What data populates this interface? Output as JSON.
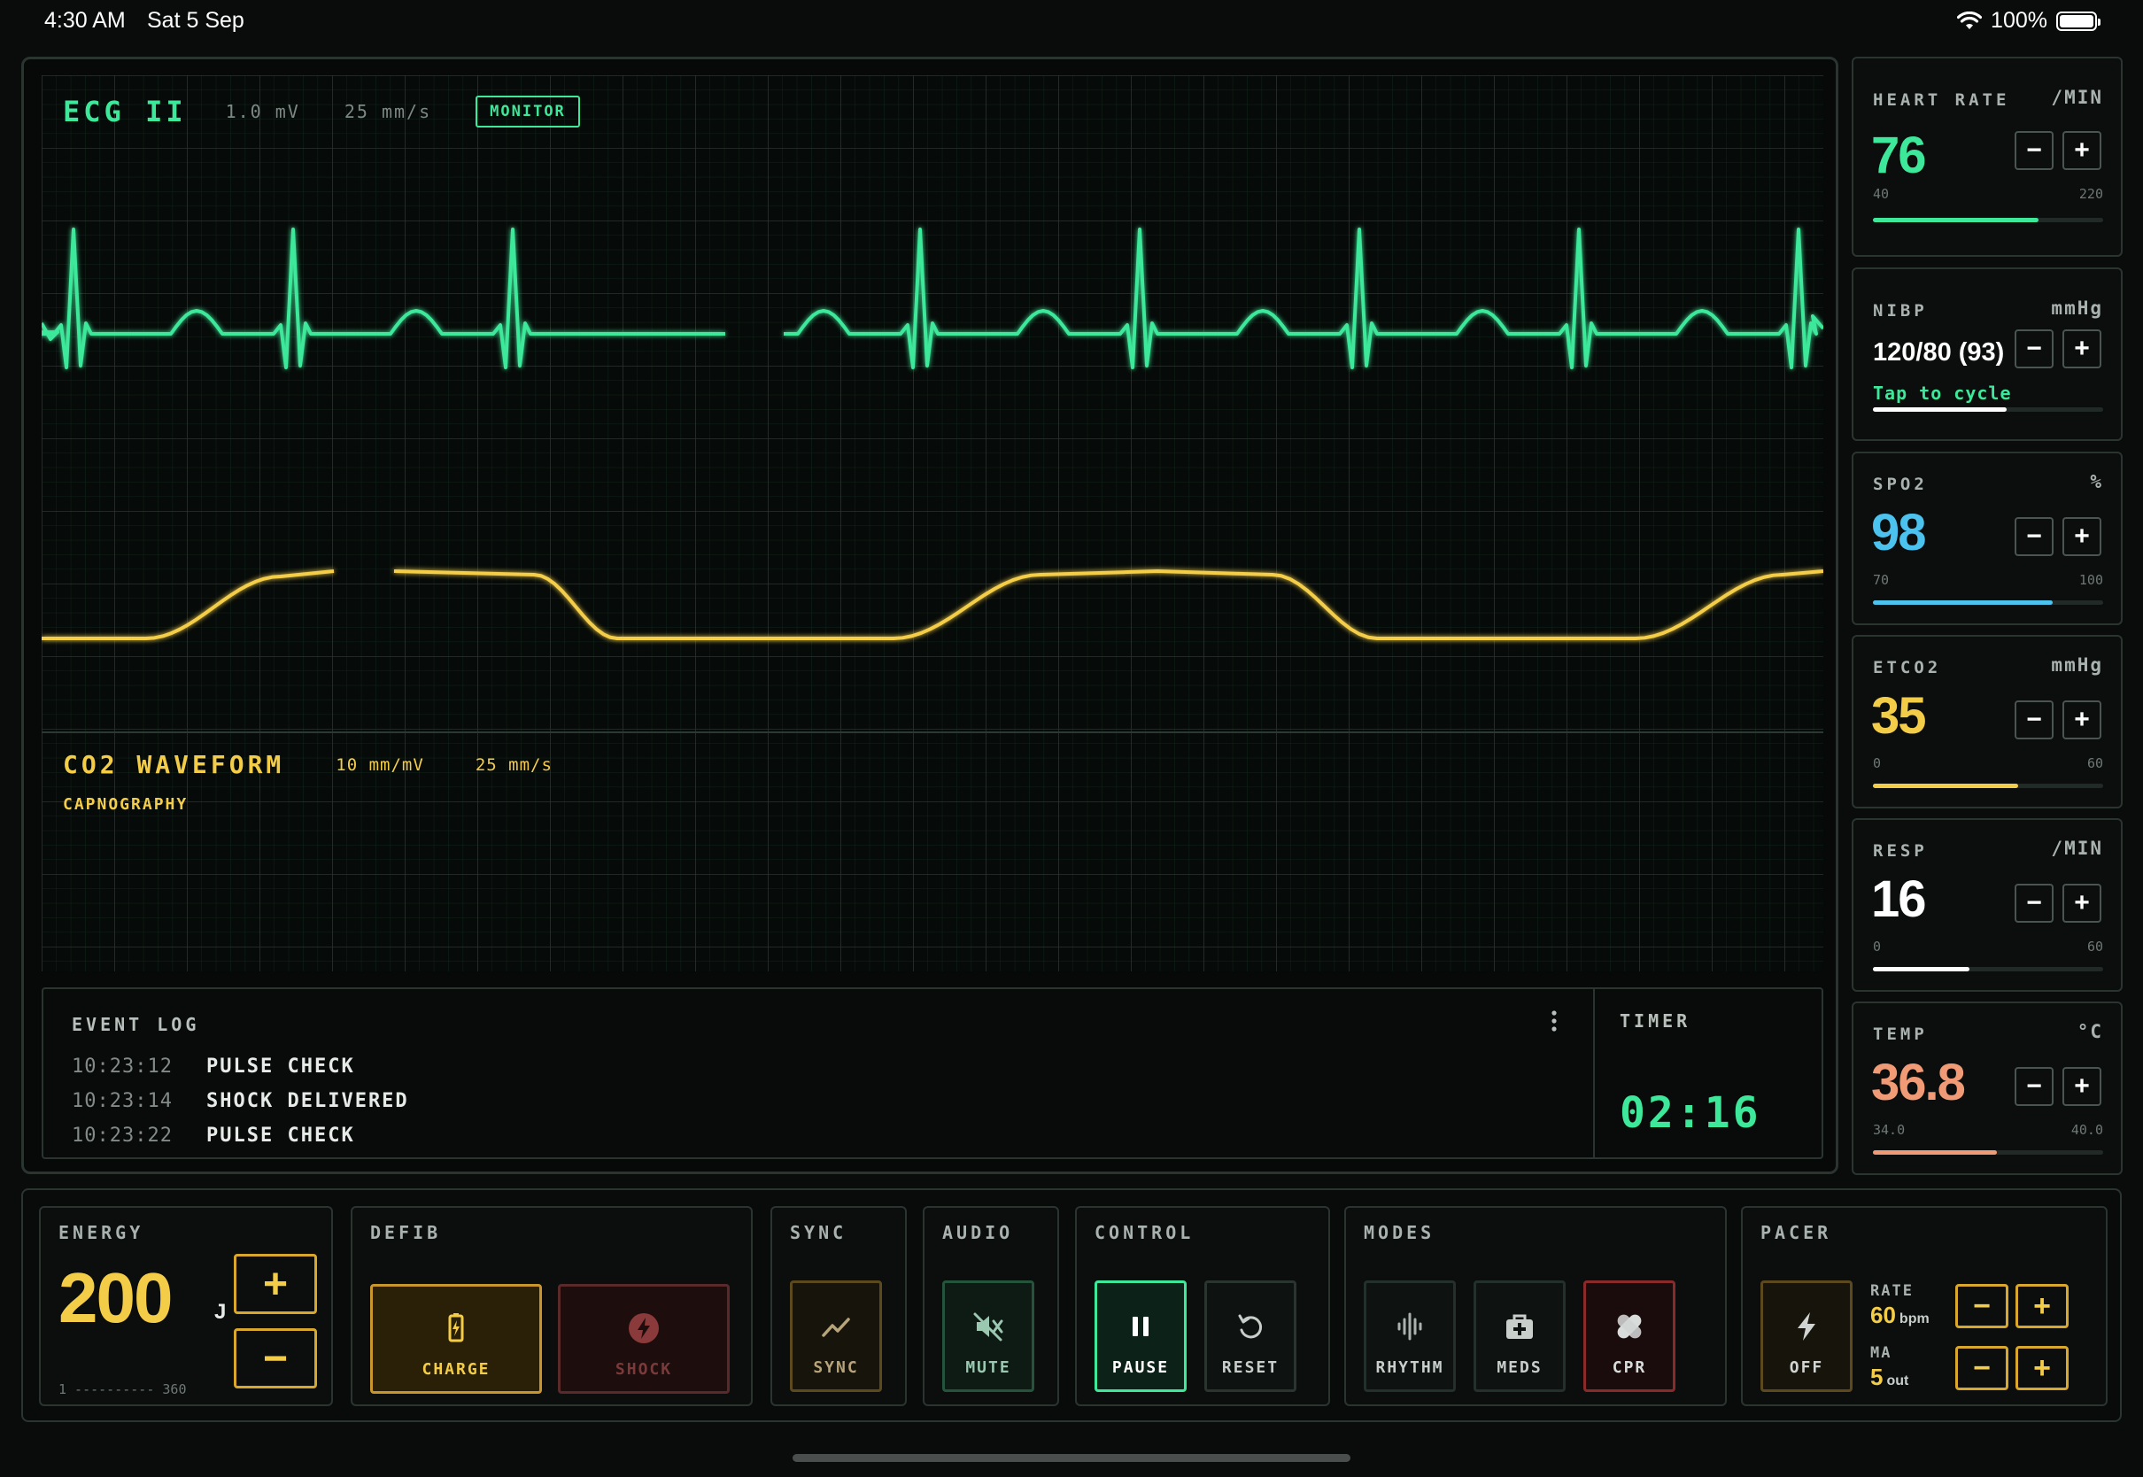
{
  "status_bar": {
    "time": "4:30 AM",
    "date": "Sat 5 Sep",
    "battery": "100%"
  },
  "ecg": {
    "title": "ECG II",
    "gain": "1.0 mV",
    "speed": "25 mm/s",
    "badge": "MONITOR",
    "color": "#3ee89a"
  },
  "co2": {
    "title": "CO2 WAVEFORM",
    "scale": "10 mm/mV",
    "speed": "25 mm/s",
    "subtitle": "CAPNOGRAPHY",
    "color": "#f4cd48"
  },
  "event_log": {
    "label": "EVENT LOG",
    "more_icon": "more-vertical-icon",
    "entries": [
      {
        "time": "10:23:12",
        "event": "PULSE CHECK"
      },
      {
        "time": "10:23:14",
        "event": "SHOCK DELIVERED"
      },
      {
        "time": "10:23:22",
        "event": "PULSE CHECK"
      }
    ]
  },
  "timer": {
    "label": "TIMER",
    "value": "02:16"
  },
  "vitals": {
    "heart_rate": {
      "name": "HEART RATE",
      "unit": "/MIN",
      "value": "76",
      "min": "40",
      "max": "220",
      "fill": 0.72,
      "color": "#3ee89a"
    },
    "nibp": {
      "name": "NIBP",
      "unit": "mmHg",
      "value": "120/80 (93)",
      "hint": "Tap to cycle",
      "fill": 0.58,
      "color": "#ffffff"
    },
    "spo2": {
      "name": "SPO2",
      "unit": "%",
      "value": "98",
      "min": "70",
      "max": "100",
      "fill": 0.78,
      "color": "#4cc3ee"
    },
    "etco2": {
      "name": "ETCO2",
      "unit": "mmHg",
      "value": "35",
      "min": "0",
      "max": "60",
      "fill": 0.63,
      "color": "#f4cd48"
    },
    "resp": {
      "name": "RESP",
      "unit": "/MIN",
      "value": "16",
      "min": "0",
      "max": "60",
      "fill": 0.42,
      "color": "#ffffff"
    },
    "temp": {
      "name": "TEMP",
      "unit": "°C",
      "value": "36.8",
      "min": "34.0",
      "max": "40.0",
      "fill": 0.54,
      "color": "#f09a76"
    },
    "minus": "−",
    "plus": "+"
  },
  "controls": {
    "energy": {
      "label": "ENERGY",
      "value": "200",
      "unit": "J",
      "range": "1 ---------- 360",
      "plus": "+",
      "minus": "−"
    },
    "defib": {
      "label": "DEFIB",
      "charge": "CHARGE",
      "shock": "SHOCK"
    },
    "sync": {
      "label": "SYNC",
      "button": "SYNC"
    },
    "audio": {
      "label": "AUDIO",
      "button": "MUTE"
    },
    "control": {
      "label": "CONTROL",
      "pause": "PAUSE",
      "reset": "RESET"
    },
    "modes": {
      "label": "MODES",
      "rhythm": "RHYTHM",
      "meds": "MEDS",
      "cpr": "CPR"
    },
    "pacer": {
      "label": "PACER",
      "button": "OFF",
      "rate_label": "RATE",
      "rate_value": "60",
      "rate_unit": "bpm",
      "ma_label": "MA",
      "ma_value": "5",
      "ma_unit": "out",
      "minus": "−",
      "plus": "+"
    }
  }
}
